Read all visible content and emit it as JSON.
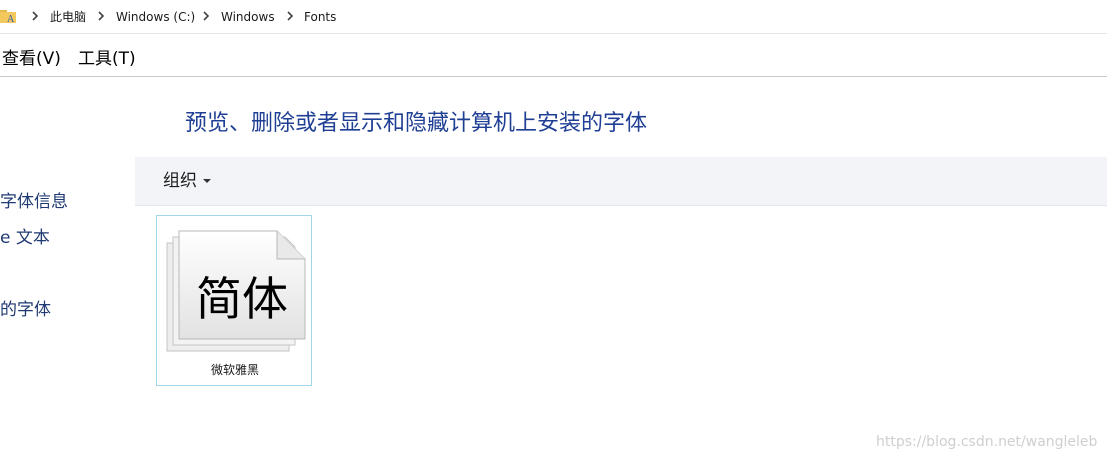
{
  "breadcrumb": {
    "items": [
      "此电脑",
      "Windows (C:)",
      "Windows",
      "Fonts"
    ]
  },
  "menubar": {
    "items": [
      "查看(V)",
      "工具(T)"
    ]
  },
  "sidebar": {
    "links": [
      "字体信息",
      "e 文本",
      "的字体"
    ]
  },
  "main": {
    "title": "预览、删除或者显示和隐藏计算机上安装的字体",
    "toolbar": {
      "organize_label": "组织"
    },
    "fonts": [
      {
        "preview_text": "简体",
        "name": "微软雅黑"
      }
    ]
  },
  "watermark": "https://blog.csdn.net/wangleleb",
  "colors": {
    "title": "#1f3f94",
    "link": "#1f3a73",
    "toolbar_bg": "#f2f4f7",
    "selection_border": "#9fd6ea",
    "folder": "#e8b84a"
  },
  "icons": {
    "folder": "folder-icon",
    "separator": "chevron-right-icon",
    "dropdown": "caret-down-icon",
    "font_file": "font-file-icon"
  }
}
